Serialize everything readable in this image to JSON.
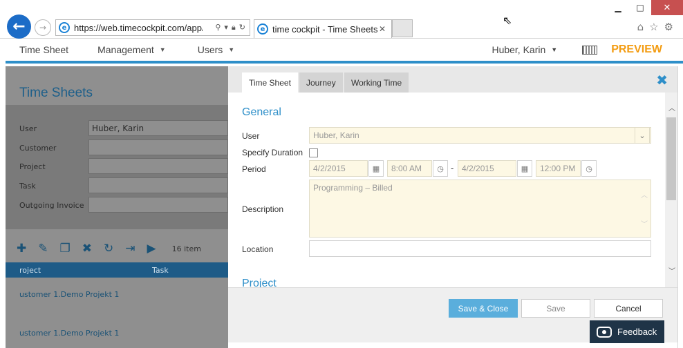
{
  "browser": {
    "window_controls": {
      "minimize": "▁",
      "maximize": "□",
      "close": "✕"
    },
    "back_icon": "←",
    "forward_icon": "→",
    "address_url": "https://web.timecockpit.com/app/l",
    "tab_title": "time cockpit - Time Sheets",
    "tab_close": "✕"
  },
  "nav": {
    "time_sheet": "Time Sheet",
    "management": "Management",
    "users": "Users",
    "user_name": "Huber, Karin",
    "preview": "PREVIEW"
  },
  "background_page": {
    "title": "Time Sheets",
    "filters": [
      {
        "label": "User",
        "value": "Huber, Karin"
      },
      {
        "label": "Customer",
        "value": ""
      },
      {
        "label": "Project",
        "value": ""
      },
      {
        "label": "Task",
        "value": ""
      },
      {
        "label": "Outgoing Invoice",
        "value": ""
      }
    ],
    "items_count": "16 item",
    "grid_headers": {
      "project": "roject",
      "task": "Task"
    },
    "rows": [
      "ustomer 1.Demo Projekt 1",
      "ustomer 1.Demo Projekt 1"
    ]
  },
  "dialog": {
    "tabs": [
      "Time Sheet",
      "Journey",
      "Working Time"
    ],
    "close_icon": "✖",
    "general_title": "General",
    "project_title": "Project",
    "fields": {
      "user_label": "User",
      "user_value": "Huber, Karin",
      "specify_duration_label": "Specify Duration",
      "period_label": "Period",
      "start_date": "4/2/2015",
      "start_time": "8:00 AM",
      "end_date": "4/2/2015",
      "end_time": "12:00 PM",
      "description_label": "Description",
      "description_value": "Programming – Billed",
      "location_label": "Location",
      "location_value": ""
    },
    "buttons": {
      "save_close": "Save & Close",
      "save": "Save",
      "cancel": "Cancel"
    }
  },
  "feedback": {
    "label": "Feedback"
  },
  "colors": {
    "accent": "#2e8fc9",
    "preview": "#f39c12",
    "primary_button": "#5aaedc",
    "required_field": "#fdf8e4"
  }
}
